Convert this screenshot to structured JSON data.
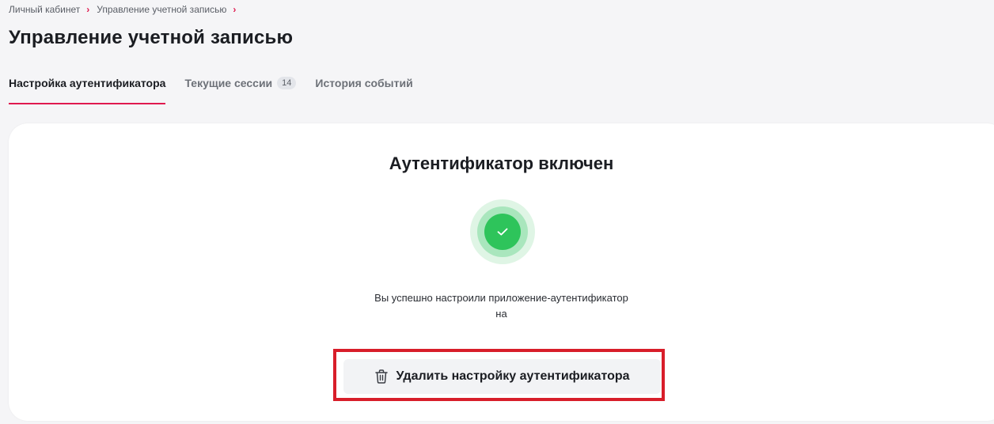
{
  "breadcrumb": {
    "items": [
      "Личный кабинет",
      "Управление учетной записью"
    ],
    "separator": "›"
  },
  "page": {
    "title": "Управление учетной записью"
  },
  "tabs": [
    {
      "label": "Настройка аутентификатора",
      "active": true
    },
    {
      "label": "Текущие сессии",
      "badge": "14",
      "active": false
    },
    {
      "label": "История событий",
      "active": false
    }
  ],
  "card": {
    "title": "Аутентификатор включен",
    "status_icon": "check-circle-icon",
    "description_line1": "Вы успешно настроили приложение-аутентификатор",
    "description_line2": "на",
    "delete_button": {
      "label": "Удалить настройку аутентификатора",
      "icon": "trash-icon"
    }
  },
  "colors": {
    "accent": "#e0194f",
    "success": "#2ec45b",
    "highlight": "#d81e2a"
  }
}
